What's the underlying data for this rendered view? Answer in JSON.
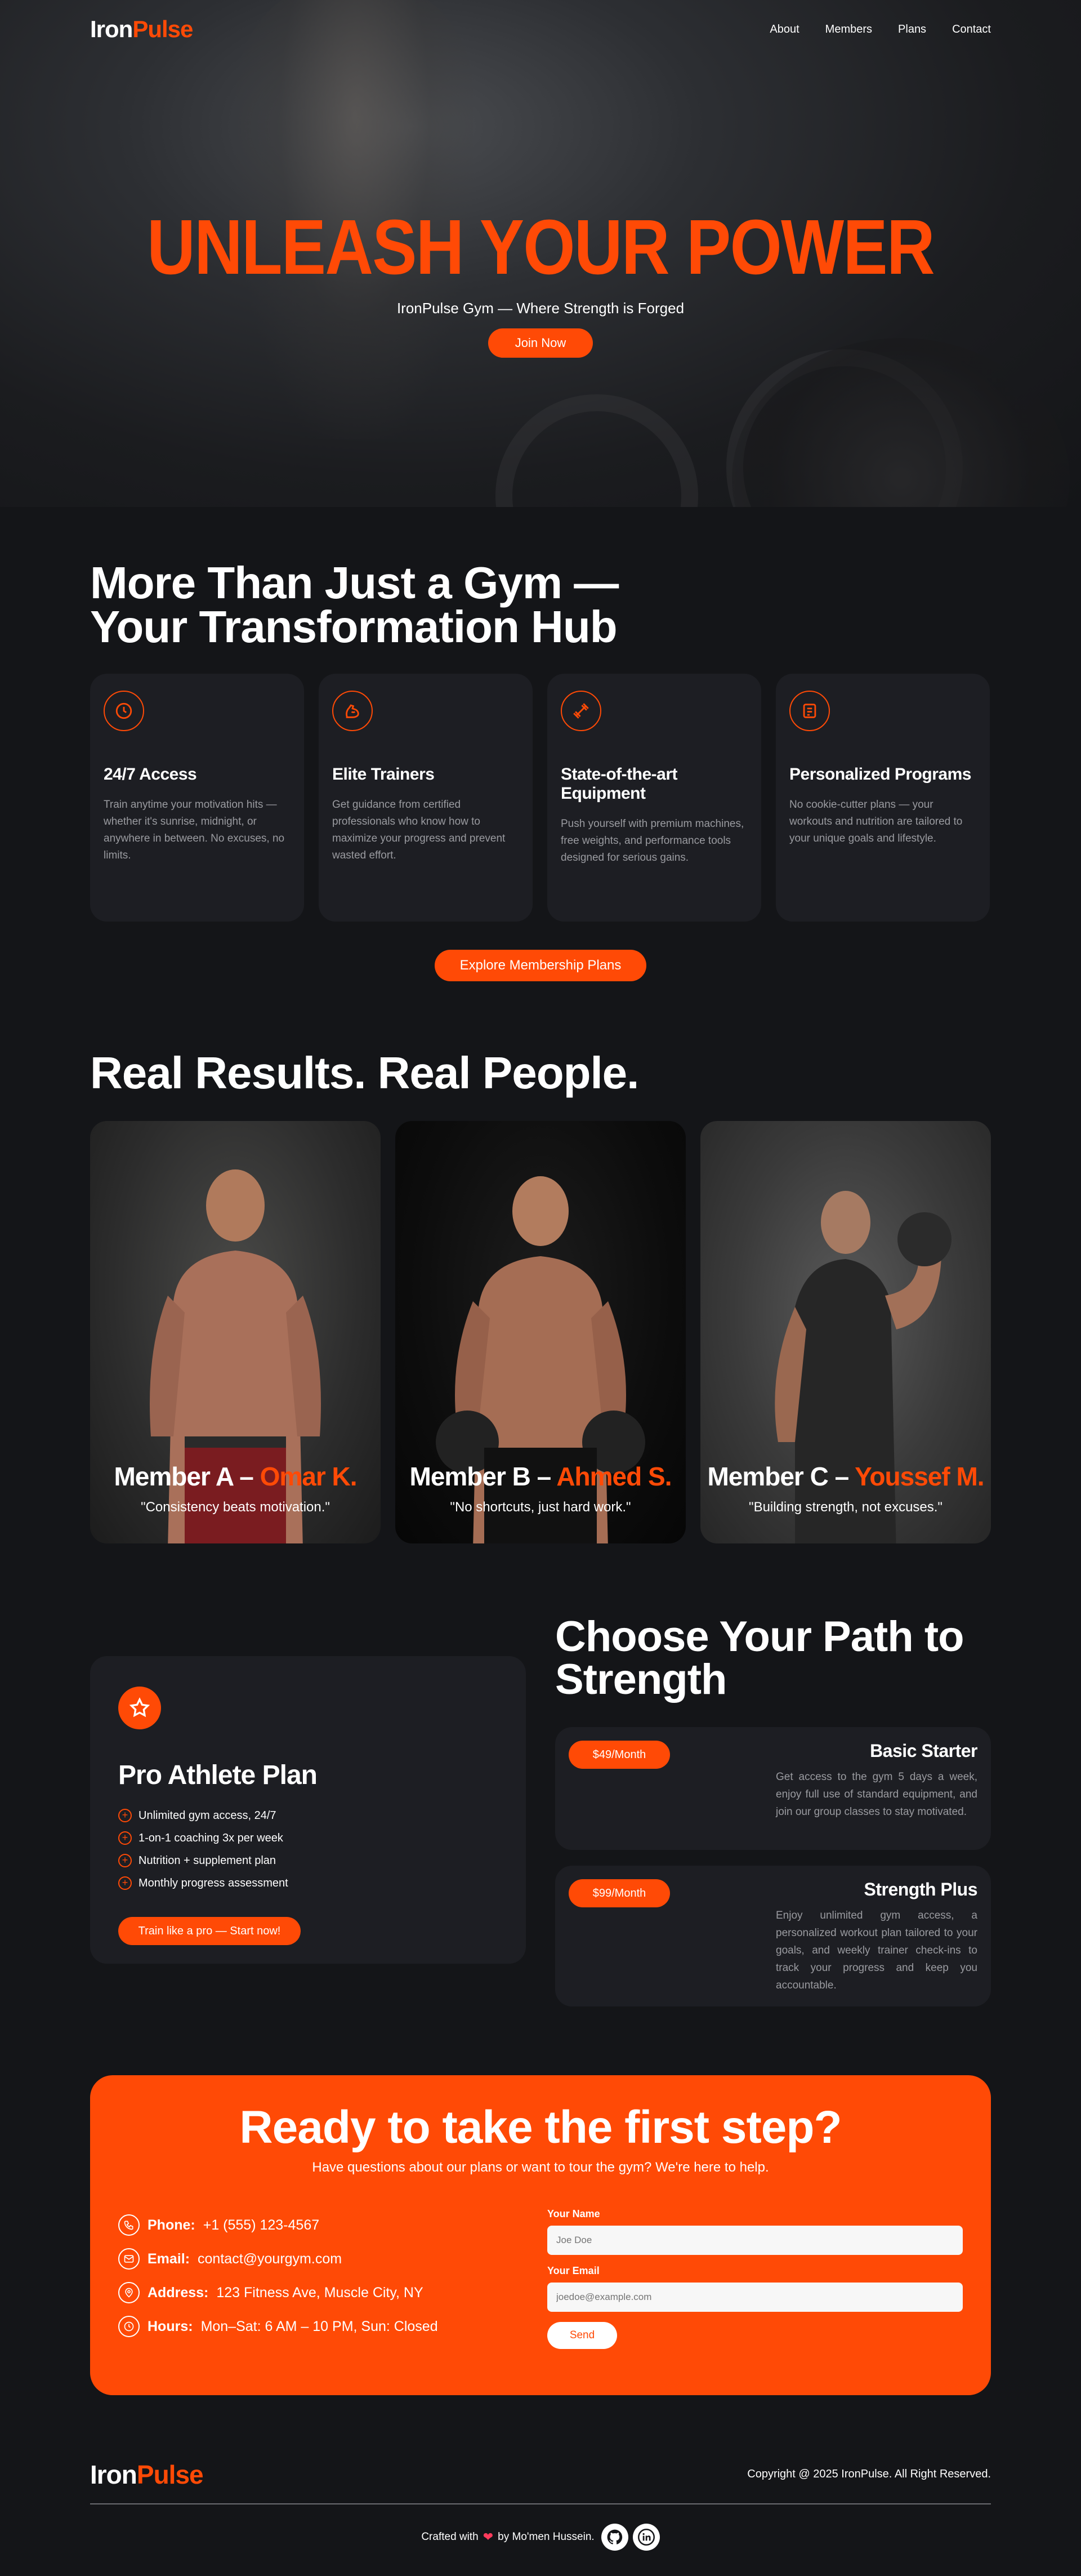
{
  "nav": {
    "logo_a": "Iron",
    "logo_b": "Pulse",
    "links": [
      "About",
      "Members",
      "Plans",
      "Contact"
    ]
  },
  "hero": {
    "title": "UNLEASH YOUR POWER",
    "subtitle": "IronPulse Gym — Where Strength is Forged",
    "cta": "Join Now"
  },
  "features": {
    "title_line1": "More Than Just a Gym —",
    "title_line2": "Your Transformation Hub",
    "cards": [
      {
        "icon": "clock-icon",
        "title": "24/7 Access",
        "text": "Train anytime your motivation hits — whether it's sunrise, midnight, or anywhere in between. No excuses, no limits."
      },
      {
        "icon": "muscle-icon",
        "title": "Elite Trainers",
        "text": "Get guidance from certified professionals who know how to maximize your progress and prevent wasted effort."
      },
      {
        "icon": "dumbbell-icon",
        "title": "State-of-the-art Equipment",
        "text": "Push yourself with premium machines, free weights, and performance tools designed for serious gains."
      },
      {
        "icon": "document-icon",
        "title": "Personalized Programs",
        "text": "No cookie-cutter plans — your workouts and nutrition are tailored to your unique goals and lifestyle."
      }
    ],
    "cta": "Explore Membership Plans"
  },
  "results": {
    "title": "Real Results. Real People.",
    "members": [
      {
        "label": "Member A –",
        "name": "Omar K.",
        "quote": "\"Consistency beats motivation.\""
      },
      {
        "label": "Member B –",
        "name": "Ahmed S.",
        "quote": "\"No shortcuts, just hard work.\""
      },
      {
        "label": "Member C –",
        "name": "Youssef M.",
        "quote": "\"Building strength, not excuses.\""
      }
    ]
  },
  "plans": {
    "title_line1": "Choose Your Path to",
    "title_line2": "Strength",
    "pro": {
      "name": "Pro Athlete Plan",
      "features": [
        "Unlimited gym access, 24/7",
        "1-on-1 coaching 3x per week",
        "Nutrition + supplement plan",
        "Monthly progress assessment"
      ],
      "cta": "Train like a pro — Start now!"
    },
    "items": [
      {
        "price": "$49/Month",
        "name": "Basic Starter",
        "desc": "Get access to the gym 5 days a week, enjoy full use of standard equipment, and join our group classes to stay motivated."
      },
      {
        "price": "$99/Month",
        "name": "Strength Plus",
        "desc": "Enjoy unlimited gym access, a personalized workout plan tailored to your goals, and weekly trainer check-ins to track your progress and keep you accountable."
      }
    ]
  },
  "cta": {
    "title": "Ready to take the first step?",
    "subtitle": "Have questions about our plans or want to tour the gym? We're here to help.",
    "contact": [
      {
        "icon": "phone-icon",
        "label": "Phone:",
        "value": "+1 (555) 123-4567"
      },
      {
        "icon": "email-icon",
        "label": "Email:",
        "value": "contact@yourgym.com"
      },
      {
        "icon": "location-icon",
        "label": "Address:",
        "value": "123 Fitness Ave, Muscle City, NY"
      },
      {
        "icon": "clock-icon",
        "label": "Hours:",
        "value": "Mon–Sat: 6 AM – 10 PM, Sun: Closed"
      }
    ],
    "form": {
      "name_label": "Your Name",
      "name_placeholder": "Joe Doe",
      "email_label": "Your Email",
      "email_placeholder": "joedoe@example.com",
      "send": "Send"
    }
  },
  "footer": {
    "logo_a": "Iron",
    "logo_b": "Pulse",
    "copyright": "Copyright @ 2025 IronPulse. All Right Reserved.",
    "credit_a": "Crafted with",
    "credit_b": "by Mo'men Hussein.",
    "social": [
      "github-icon",
      "linkedin-icon"
    ]
  },
  "colors": {
    "accent": "#ff4a06",
    "background": "#141518",
    "card": "#1d1e23"
  }
}
